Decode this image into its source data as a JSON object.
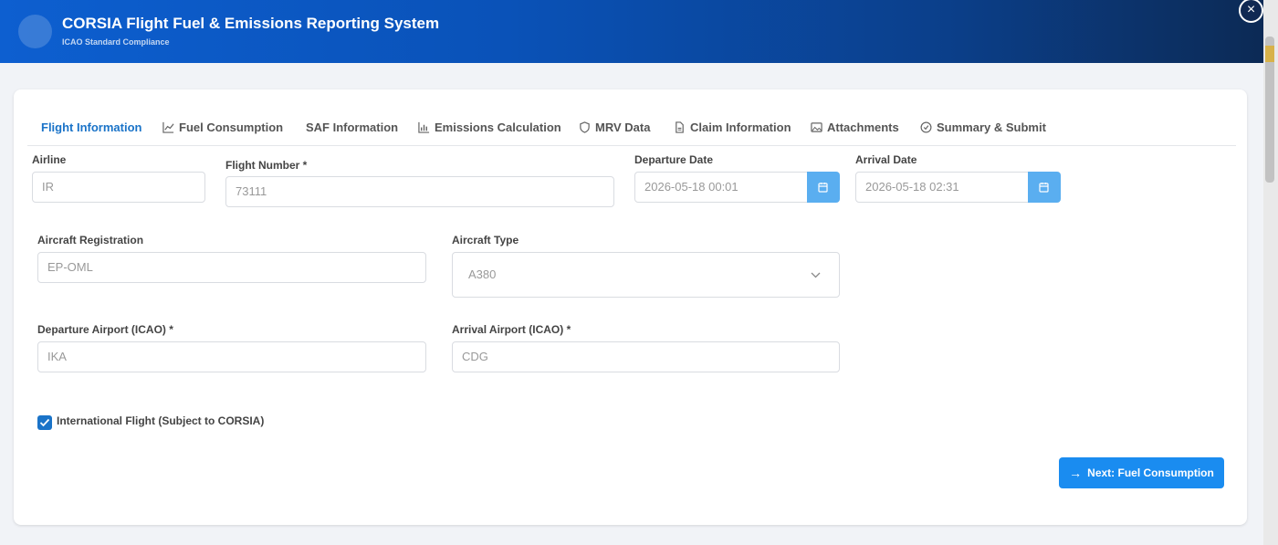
{
  "header": {
    "title": "CORSIA Flight Fuel & Emissions Reporting System",
    "subtitle": "ICAO Standard Compliance",
    "close_label": "×"
  },
  "tabs": [
    {
      "label": "Flight Information",
      "icon": "none",
      "active": true
    },
    {
      "label": "Fuel Consumption",
      "icon": "line-chart-icon"
    },
    {
      "label": "SAF Information",
      "icon": "none"
    },
    {
      "label": "Emissions Calculation",
      "icon": "bar-chart-icon"
    },
    {
      "label": "MRV Data",
      "icon": "shield-icon"
    },
    {
      "label": "Claim Information",
      "icon": "document-icon"
    },
    {
      "label": "Attachments",
      "icon": "image-icon"
    },
    {
      "label": "Summary & Submit",
      "icon": "check-circle-icon"
    }
  ],
  "form": {
    "airline": {
      "label": "Airline",
      "value": "IR"
    },
    "flight_number": {
      "label": "Flight Number *",
      "value": "73111"
    },
    "departure_date": {
      "label": "Departure Date",
      "value": "2026-05-18 00:01"
    },
    "arrival_date": {
      "label": "Arrival Date",
      "value": "2026-05-18 02:31"
    },
    "aircraft_registration": {
      "label": "Aircraft Registration",
      "value": "EP-OML"
    },
    "aircraft_type": {
      "label": "Aircraft Type",
      "value": "A380"
    },
    "departure_airport": {
      "label": "Departure Airport (ICAO) *",
      "value": "IKA"
    },
    "arrival_airport": {
      "label": "Arrival Airport (ICAO) *",
      "value": "CDG"
    },
    "international_flight": {
      "label": "International Flight (Subject to CORSIA)",
      "checked": true
    }
  },
  "actions": {
    "next_label": "Next: Fuel Consumption",
    "next_arrow": "→"
  },
  "colors": {
    "accent": "#1a73c8",
    "button": "#1a8cf0",
    "date_button": "#5aaef0"
  }
}
